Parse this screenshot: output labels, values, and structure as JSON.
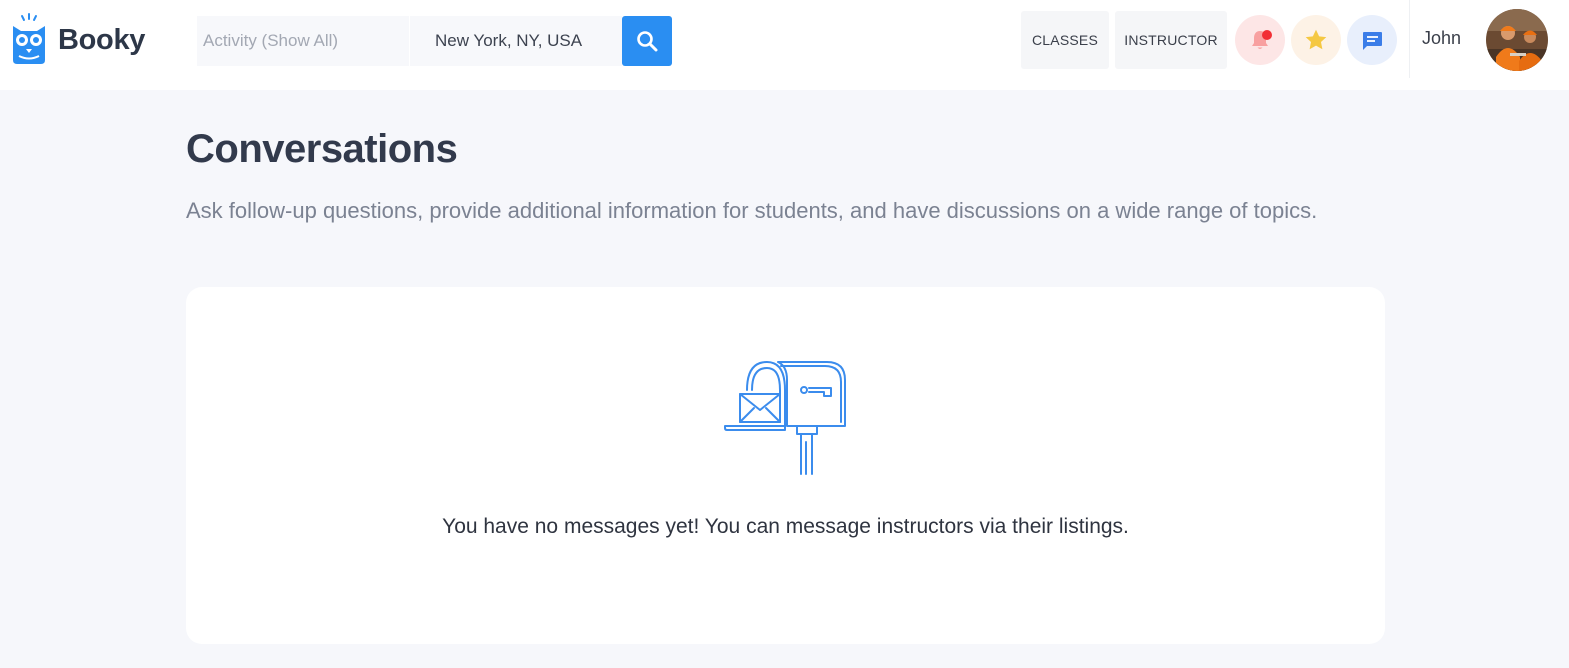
{
  "header": {
    "brand": "Booky",
    "search": {
      "activity_placeholder": "Activity (Show All)",
      "location_value": "New York, NY, USA"
    },
    "nav": {
      "classes_label": "CLASSES",
      "instructor_label": "INSTRUCTOR"
    },
    "icons": {
      "notifications": "bell-icon",
      "favorites": "star-icon",
      "messages": "chat-icon",
      "search": "search-icon"
    },
    "user_name": "John"
  },
  "main": {
    "title": "Conversations",
    "subtitle": "Ask follow-up questions, provide additional information for students, and have discussions on a wide range of topics.",
    "empty_state": {
      "icon": "mailbox-icon",
      "message": "You have no messages yet! You can message instructors via their listings."
    }
  },
  "colors": {
    "accent": "#2a8ef2",
    "background": "#f6f7fb",
    "notification_dot": "#f22e35",
    "star": "#f5c842"
  }
}
